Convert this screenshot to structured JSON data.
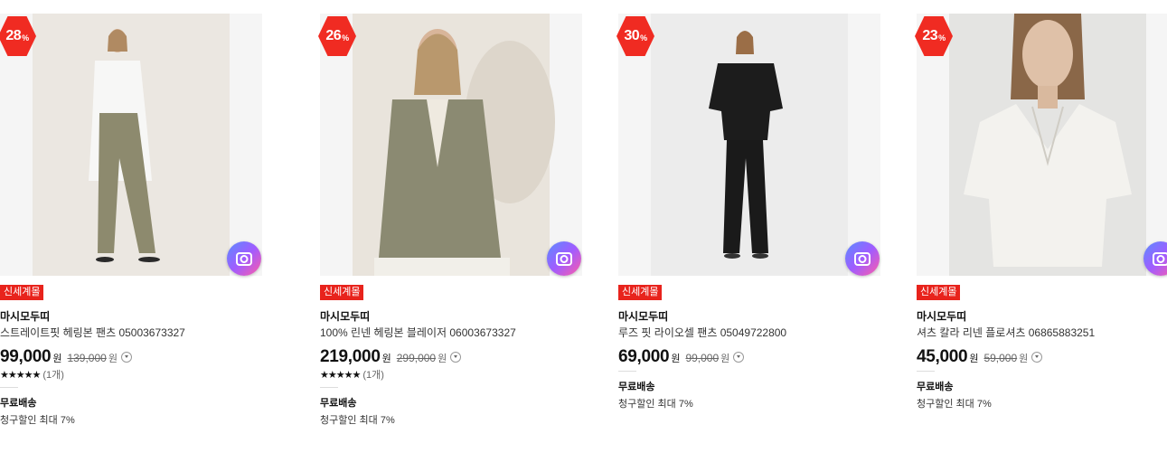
{
  "products": [
    {
      "discount": "26",
      "pct_unit": "%",
      "store": "신세계몰",
      "brand": "마시모두띠",
      "name": "100% 린넨 헤링본 블레이저 06003673327",
      "price": "219,000",
      "currency": "원",
      "original_price": "299,000",
      "stars": "★★★★★",
      "review_count": "(1개)",
      "shipping": "무료배송",
      "card_discount": "청구할인 최대 7%"
    },
    {
      "discount": "30",
      "pct_unit": "%",
      "store": "신세계몰",
      "brand": "마시모두띠",
      "name": "루즈 핏 라이오셀 팬츠 05049722800",
      "price": "69,000",
      "currency": "원",
      "original_price": "99,000",
      "shipping": "무료배송",
      "card_discount": "청구할인 최대 7%"
    },
    {
      "discount": "23",
      "pct_unit": "%",
      "store": "신세계몰",
      "brand": "마시모두띠",
      "name": "셔츠 칼라 리넨 플로셔츠 06865883251",
      "price": "45,000",
      "currency": "원",
      "original_price": "59,000",
      "shipping": "무료배송",
      "card_discount": "청구할인 최대 7%"
    },
    {
      "discount": "28",
      "pct_unit": "%",
      "store": "신세계몰",
      "brand": "마시모두띠",
      "name": "스트레이트핏 헤링본 팬츠 05003673327",
      "price": "99,000",
      "currency": "원",
      "original_price": "139,000",
      "stars": "★★★★★",
      "review_count": "(1개)",
      "shipping": "무료배송",
      "card_discount": "청구할인 최대 7%"
    }
  ],
  "icons": {
    "discount_badge": "hexagon",
    "image_search": "camera-icon",
    "price_info": "chevron-down-circle-icon"
  },
  "colors": {
    "badge": "#f02b22",
    "store_tag": "#e8231c"
  }
}
